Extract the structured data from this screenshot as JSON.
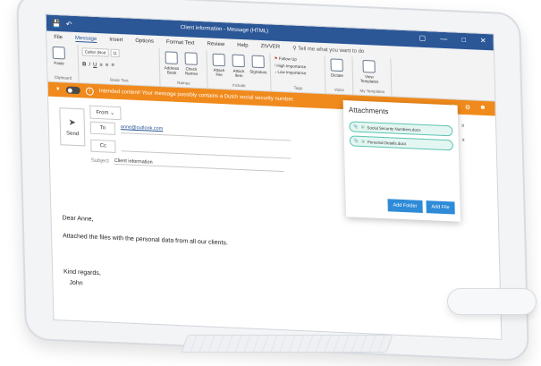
{
  "window": {
    "title": "Client information - Message (HTML)",
    "controls": [
      "▢",
      "—",
      "□",
      "✕"
    ]
  },
  "ribbon_tabs": [
    "File",
    "Message",
    "Insert",
    "Options",
    "Format Text",
    "Review",
    "Help",
    "ZIVVER"
  ],
  "tell_me": "Tell me what you want to do",
  "ribbon": {
    "paste": "Paste",
    "clipboard": "Clipboard",
    "font_name": "Calibri (Bod",
    "font_size": "11",
    "basic_text": "Basic Text",
    "address_book": "Address Book",
    "check_names": "Check Names",
    "names": "Names",
    "attach_file": "Attach File",
    "attach_item": "Attach Item",
    "signature": "Signature",
    "include": "Include",
    "follow_up": "Follow Up",
    "high_importance": "High Importance",
    "low_importance": "Low Importance",
    "tags": "Tags",
    "dictate": "Dictate",
    "voice": "Voice",
    "view_templates": "View Templates",
    "my_templates": "My Templates"
  },
  "warning": {
    "text": "Intended content! Your message possibly contains a Dutch social security number."
  },
  "compose": {
    "send": "Send",
    "from": "From",
    "to": "To",
    "to_value": "anne@outlook.com",
    "cc": "Cc",
    "subject_label": "Subject",
    "subject_value": "Client information"
  },
  "attachments": {
    "title": "Attachments",
    "files": [
      "Social Security Numbers.docx",
      "Personal Details.docx"
    ],
    "add_folder": "Add Folder",
    "add_file": "Add File"
  },
  "body": {
    "greeting": "Dear Anne,",
    "line1": "Attached the files with the personal data from all our clients.",
    "closing": "Kind regards,",
    "signature": "John"
  },
  "colors": {
    "titlebar": "#2b5797",
    "warning": "#f08a1c",
    "button": "#2f8bd8",
    "attachment_fill": "#e4f6f2"
  }
}
